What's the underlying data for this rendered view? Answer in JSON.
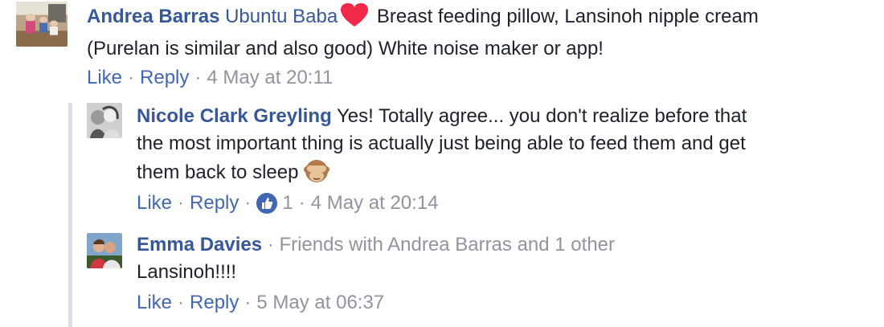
{
  "comments": [
    {
      "author": "Andrea Barras",
      "mention": "Ubuntu Baba",
      "emoji_icon": "red-heart-icon",
      "text_line1": "Breast feeding pillow, Lansinoh nipple cream",
      "text_line2": "(Purelan is similar and also good) White noise maker or app!",
      "like_label": "Like",
      "reply_label": "Reply",
      "timestamp": "4 May at 20:11"
    },
    {
      "author": "Nicole Clark Greyling",
      "text_line1": "Yes! Totally agree... you don't realize before that",
      "text_line2": "the most important thing is actually just being able to feed them and get",
      "text_line3": "them back to sleep",
      "emoji_icon": "see-no-evil-monkey-icon",
      "like_label": "Like",
      "reply_label": "Reply",
      "reaction_count": "1",
      "timestamp": "4 May at 20:14"
    },
    {
      "author": "Emma Davies",
      "friends_text": "Friends with Andrea Barras and 1 other",
      "text": "Lansinoh!!!!",
      "like_label": "Like",
      "reply_label": "Reply",
      "timestamp": "5 May at 06:37"
    }
  ],
  "colors": {
    "author_link": "#365899",
    "action_link": "#4267b2",
    "muted": "#90949c",
    "heart": "#f0284a",
    "like_badge": "#4267b2"
  }
}
